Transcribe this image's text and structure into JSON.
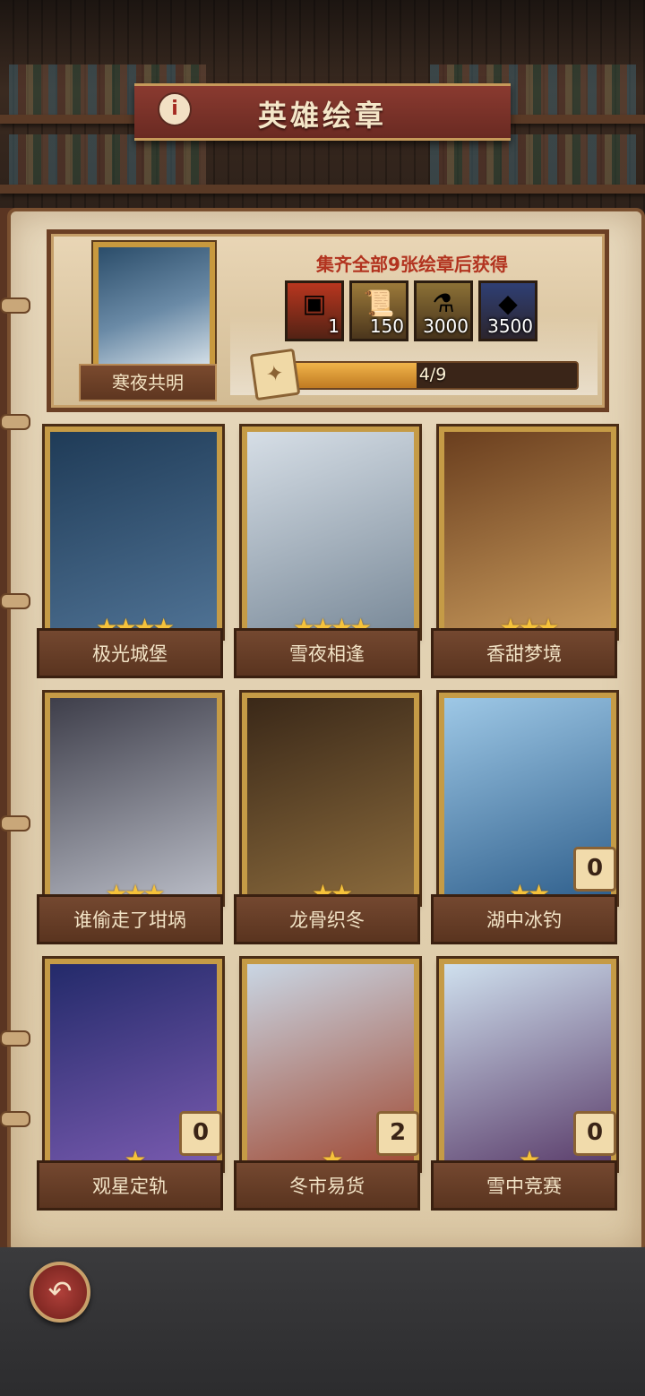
{
  "header": {
    "title": "英雄绘章",
    "info_icon": "i"
  },
  "reward_panel": {
    "album_name": "寒夜共明",
    "reward_caption": "集齐全部9张绘章后获得",
    "rewards": [
      {
        "icon": "gold-cube-icon",
        "count": "1",
        "bg": "#b8361f"
      },
      {
        "icon": "scroll-icon",
        "count": "150",
        "bg": "#9c7a3a"
      },
      {
        "icon": "potion-icon",
        "count": "3000",
        "bg": "#8c7136"
      },
      {
        "icon": "ore-icon",
        "count": "3500",
        "bg": "#2f3f74"
      }
    ],
    "progress": {
      "text": "4/9",
      "fraction": 0.444
    }
  },
  "cards": [
    {
      "title": "极光城堡",
      "stars": 4,
      "badge": null,
      "colors": [
        "#1f3b57",
        "#4f7294"
      ]
    },
    {
      "title": "雪夜相逢",
      "stars": 4,
      "badge": null,
      "colors": [
        "#d6dee6",
        "#7a8a99"
      ]
    },
    {
      "title": "香甜梦境",
      "stars": 3,
      "badge": null,
      "colors": [
        "#6a3e1e",
        "#c89a5c"
      ]
    },
    {
      "title": "谁偷走了坩埚",
      "stars": 3,
      "badge": null,
      "colors": [
        "#3e3e4a",
        "#b9bcc6"
      ]
    },
    {
      "title": "龙骨织冬",
      "stars": 2,
      "badge": null,
      "colors": [
        "#3a2818",
        "#8a6a3c"
      ]
    },
    {
      "title": "湖中冰钓",
      "stars": 2,
      "badge": "0",
      "colors": [
        "#9ec8e6",
        "#2f5f8c"
      ]
    },
    {
      "title": "观星定轨",
      "stars": 1,
      "badge": "0",
      "colors": [
        "#232a6a",
        "#7a5bb0"
      ]
    },
    {
      "title": "冬市易货",
      "stars": 1,
      "badge": "2",
      "colors": [
        "#c9d6e4",
        "#a04a34"
      ]
    },
    {
      "title": "雪中竞赛",
      "stars": 1,
      "badge": "0",
      "colors": [
        "#cfe0ee",
        "#5a3c6a"
      ]
    }
  ],
  "footer": {
    "back_icon": "back-arrow-icon"
  }
}
